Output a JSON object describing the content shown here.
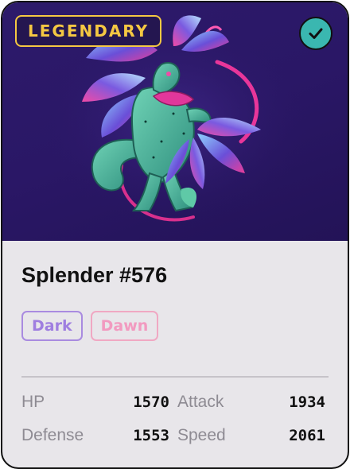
{
  "badge": {
    "label": "LEGENDARY"
  },
  "creature": {
    "name": "Splender #576",
    "image_icon": "leaf-dragon-illustration"
  },
  "status": {
    "icon": "checkmark-icon",
    "color": "#3ab7b0"
  },
  "types": [
    {
      "label": "Dark",
      "color": "#9f7ee0"
    },
    {
      "label": "Dawn",
      "color": "#f29ac0"
    }
  ],
  "stats": {
    "hp": {
      "label": "HP",
      "value": "1570"
    },
    "attack": {
      "label": "Attack",
      "value": "1934"
    },
    "defense": {
      "label": "Defense",
      "value": "1553"
    },
    "speed": {
      "label": "Speed",
      "value": "2061"
    }
  },
  "colors": {
    "art_background": "#2a1766",
    "badge_gold": "#f5c842",
    "card_background": "#e8e6ea"
  }
}
